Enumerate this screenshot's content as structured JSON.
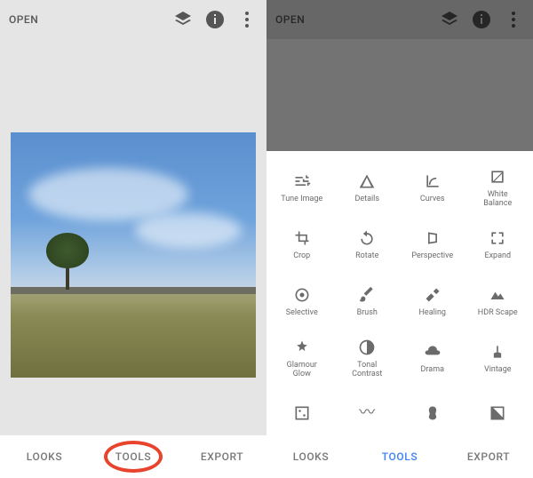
{
  "left": {
    "open_label": "OPEN",
    "nav": {
      "looks": "LOOKS",
      "tools": "TOOLS",
      "export": "EXPORT"
    }
  },
  "right": {
    "open_label": "OPEN",
    "nav": {
      "looks": "LOOKS",
      "tools": "TOOLS",
      "export": "EXPORT"
    },
    "tools": {
      "tune_image": "Tune Image",
      "details": "Details",
      "curves": "Curves",
      "white_balance": "White\nBalance",
      "crop": "Crop",
      "rotate": "Rotate",
      "perspective": "Perspective",
      "expand": "Expand",
      "selective": "Selective",
      "brush": "Brush",
      "healing": "Healing",
      "hdr_scape": "HDR Scape",
      "glamour_glow": "Glamour\nGlow",
      "tonal_contrast": "Tonal\nContrast",
      "drama": "Drama",
      "vintage": "Vintage",
      "grainy_film": "",
      "retrolux": "",
      "grunge": "",
      "black_white": ""
    }
  }
}
